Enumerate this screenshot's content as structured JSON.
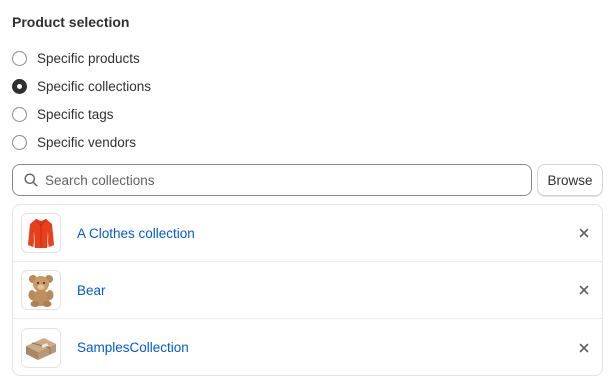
{
  "section": {
    "title": "Product selection"
  },
  "radio_options": [
    {
      "label": "Specific products",
      "checked": false
    },
    {
      "label": "Specific collections",
      "checked": true
    },
    {
      "label": "Specific tags",
      "checked": false
    },
    {
      "label": "Specific vendors",
      "checked": false
    }
  ],
  "search": {
    "placeholder": "Search collections",
    "value": "",
    "icon": "search-icon"
  },
  "browse_button": {
    "label": "Browse"
  },
  "collections": [
    {
      "name": "A Clothes collection",
      "thumbnail": "red-jacket-image",
      "remove_icon": "close-icon"
    },
    {
      "name": "Bear",
      "thumbnail": "teddy-bear-image",
      "remove_icon": "close-icon"
    },
    {
      "name": "SamplesCollection",
      "thumbnail": "package-box-image",
      "remove_icon": "close-icon"
    }
  ],
  "colors": {
    "link": "#005bd3",
    "text": "#303030",
    "border": "#8a8a8a",
    "background": "#ffffff"
  }
}
